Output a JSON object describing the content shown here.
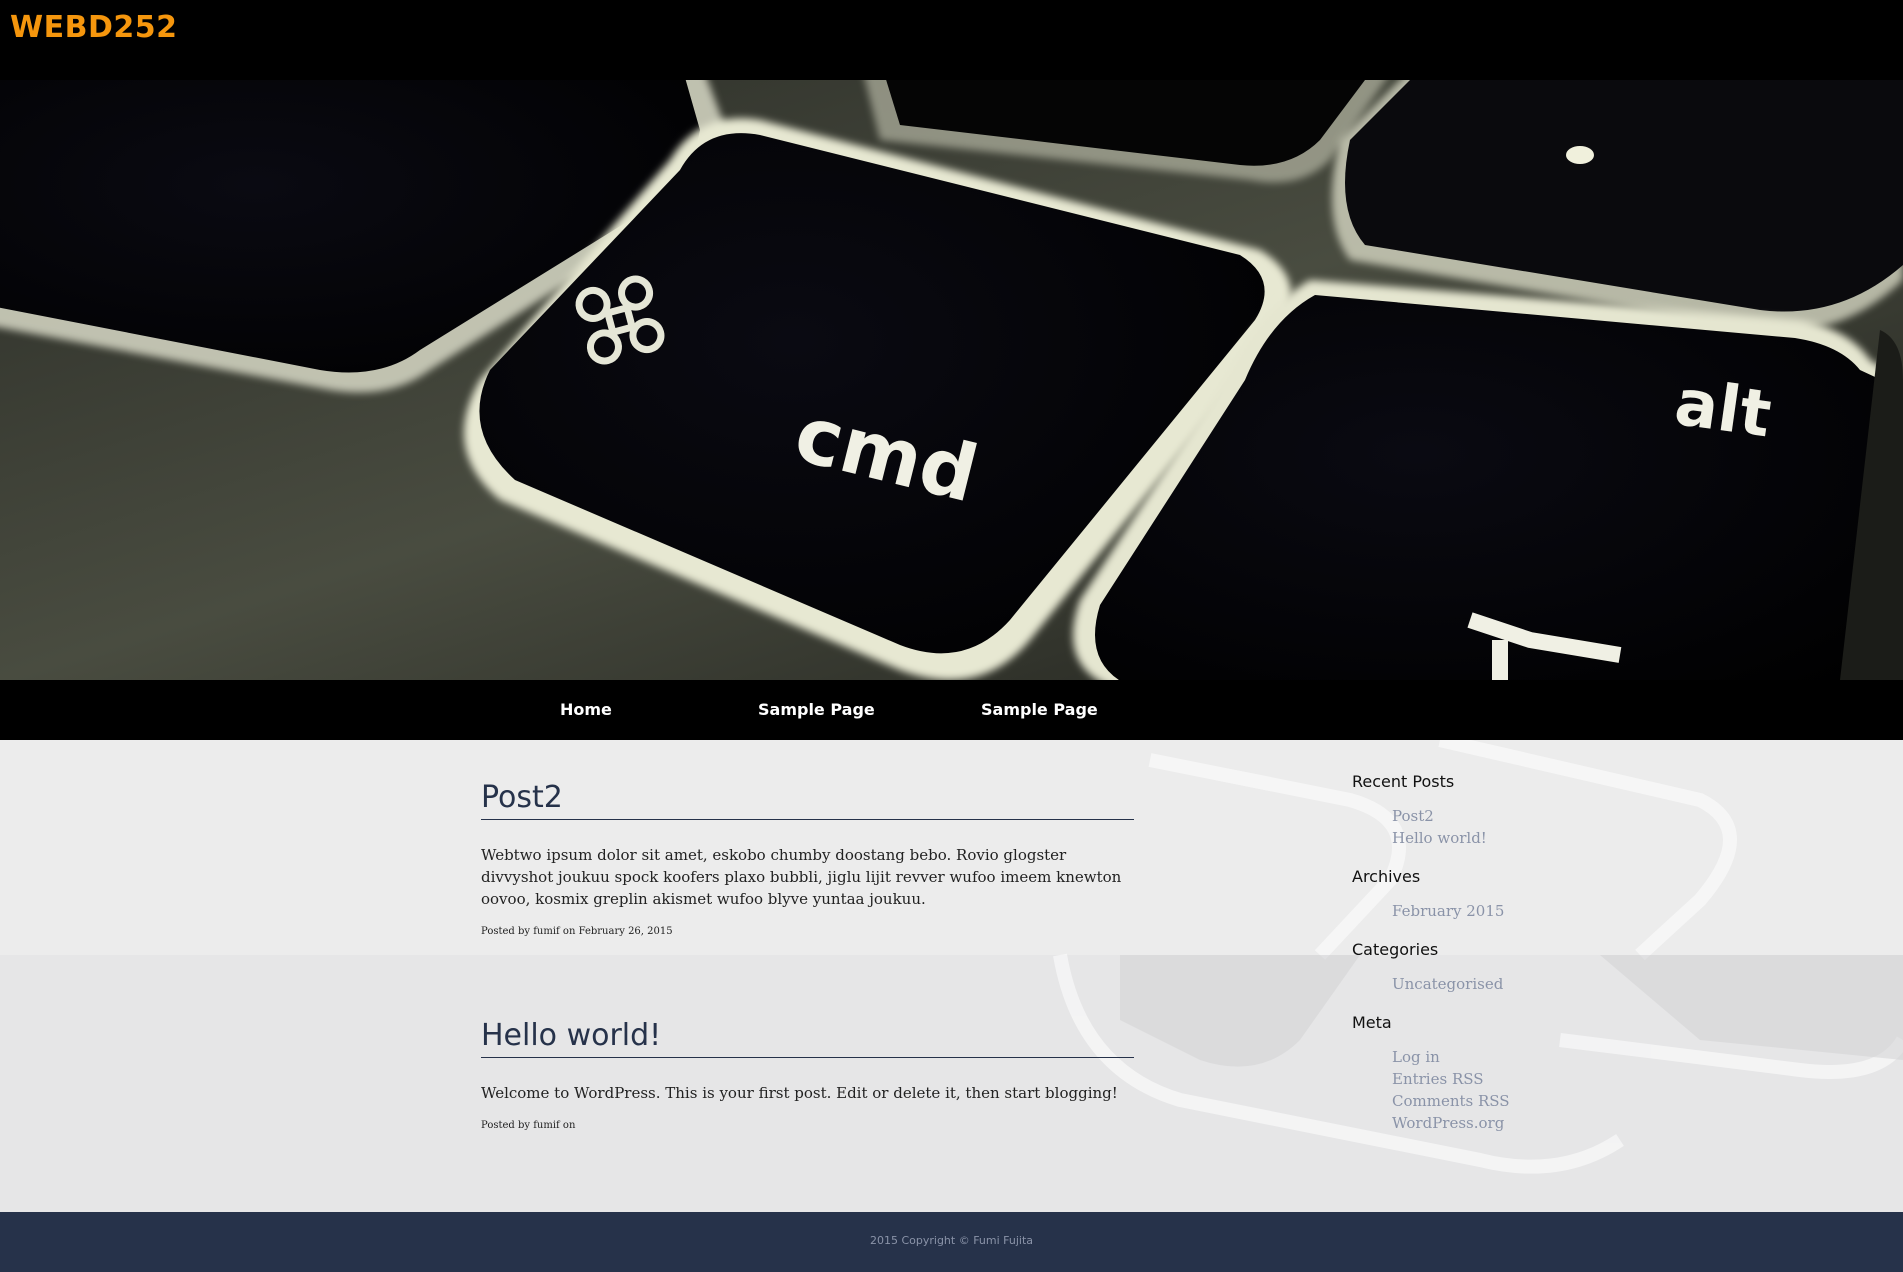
{
  "site": {
    "title": "WEBD252"
  },
  "nav": {
    "items": [
      {
        "label": "Home"
      },
      {
        "label": "Sample Page"
      },
      {
        "label": "Sample Page"
      }
    ]
  },
  "hero": {
    "key_cmd": "cmd",
    "key_alt": "alt"
  },
  "posts": [
    {
      "title": "Post2",
      "body": "Webtwo ipsum dolor sit amet, eskobo chumby doostang bebo. Rovio glogster divvyshot joukuu spock koofers plaxo bubbli, jiglu lijit revver wufoo imeem knewton oovoo, kosmix greplin akismet wufoo blyve yuntaa joukuu.",
      "meta": "Posted by fumif on February 26, 2015"
    },
    {
      "title": "Hello world!",
      "body": "Welcome to WordPress. This is your first post. Edit or delete it, then start blogging!",
      "meta": "Posted by fumif on"
    }
  ],
  "sidebar": {
    "recent_posts": {
      "heading": "Recent Posts",
      "items": [
        "Post2",
        "Hello world!"
      ]
    },
    "archives": {
      "heading": "Archives",
      "items": [
        "February 2015"
      ]
    },
    "categories": {
      "heading": "Categories",
      "items": [
        "Uncategorised"
      ]
    },
    "meta": {
      "heading": "Meta",
      "items": [
        "Log in",
        "Entries RSS",
        "Comments RSS",
        "WordPress.org"
      ]
    }
  },
  "footer": {
    "copyright": "2015 Copyright © Fumi Fujita"
  },
  "colors": {
    "title_accent": "#f5960d",
    "post_heading": "#26324a",
    "footer_bg": "#26324a",
    "sidebar_link": "#8a93a8",
    "content_bg": "#e6e6e7"
  }
}
